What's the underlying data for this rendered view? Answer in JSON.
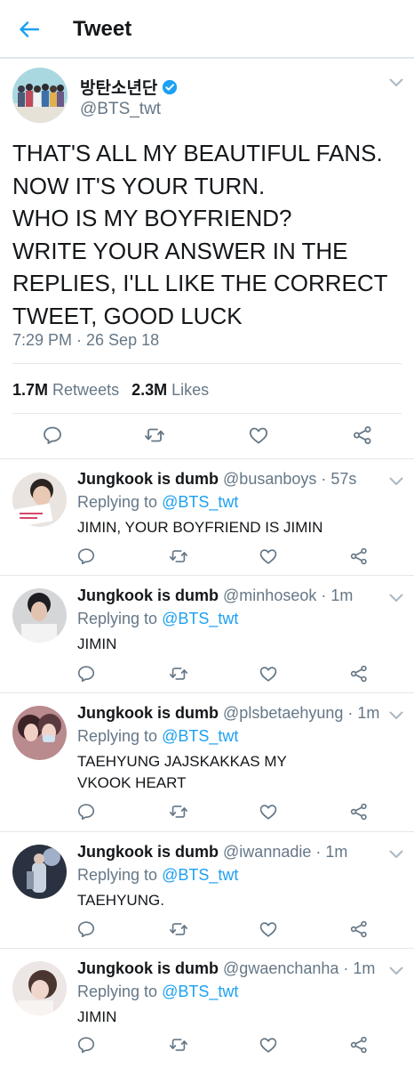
{
  "header": {
    "title": "Tweet"
  },
  "tweet": {
    "name": "방탄소년단",
    "handle": "@BTS_twt",
    "text": "THAT'S ALL MY BEAUTIFUL FANS.\nNOW IT'S YOUR TURN.\nWHO IS MY BOYFRIEND?\nWRITE YOUR ANSWER IN THE REPLIES, I'LL LIKE THE CORRECT TWEET, GOOD LUCK",
    "time": "7:29 PM · 26 Sep 18",
    "retweets_count": "1.7M",
    "retweets_label": "Retweets",
    "likes_count": "2.3M",
    "likes_label": "Likes"
  },
  "replies": [
    {
      "name": "Jungkook is dumb",
      "meta": "@busanboys · 57s",
      "replying_prefix": "Replying to",
      "replying_to": "@BTS_twt",
      "text": "JIMIN, YOUR BOYFRIEND IS JIMIN"
    },
    {
      "name": "Jungkook is dumb",
      "meta": "@minhoseok · 1m",
      "replying_prefix": "Replying to",
      "replying_to": "@BTS_twt",
      "text": "JIMIN"
    },
    {
      "name": "Jungkook is dumb",
      "meta": "@plsbetaehyung · 1m",
      "replying_prefix": "Replying to",
      "replying_to": "@BTS_twt",
      "text": "TAEHYUNG JAJSKAKKAS MY\nVKOOK HEART"
    },
    {
      "name": "Jungkook is dumb",
      "meta": "@iwannadie · 1m",
      "replying_prefix": "Replying to",
      "replying_to": "@BTS_twt",
      "text": "TAEHYUNG."
    },
    {
      "name": "Jungkook is dumb",
      "meta": "@gwaenchanha · 1m",
      "replying_prefix": "Replying to",
      "replying_to": "@BTS_twt",
      "text": "JIMIN"
    }
  ],
  "icons": {
    "back": "arrow-left-icon",
    "verified": "verified-badge-icon",
    "caret": "chevron-down-icon",
    "reply": "reply-icon",
    "retweet": "retweet-icon",
    "like": "heart-icon",
    "share": "share-icon"
  },
  "colors": {
    "accent": "#1da1f2",
    "text": "#14171a",
    "secondary": "#657786",
    "border": "#e1e8ed"
  }
}
